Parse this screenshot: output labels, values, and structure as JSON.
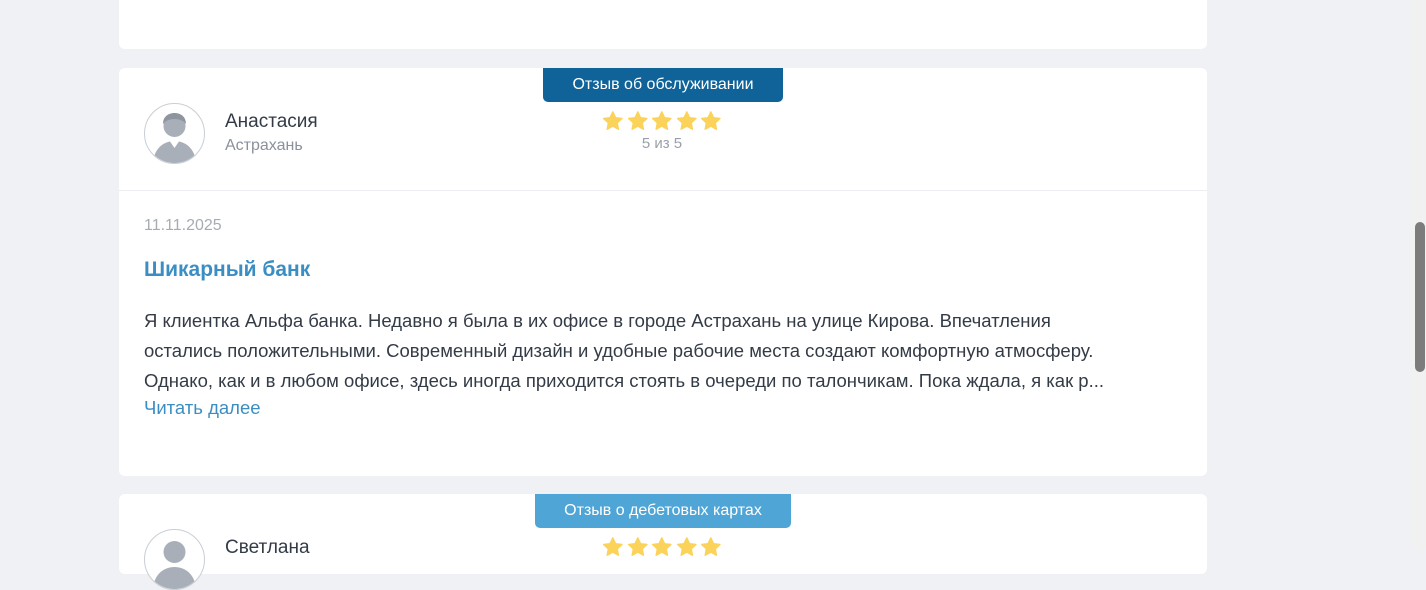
{
  "review": {
    "category": "Отзыв об обслуживании",
    "author_name": "Анастасия",
    "author_city": "Астрахань",
    "rating": 5,
    "rating_text": "5 из 5",
    "date": "11.11.2025",
    "title": "Шикарный банк",
    "body_lines": [
      "Я клиентка Альфа банка. Недавно я была в их офисе в городе Астрахань на улице Кирова. Впечатления",
      "остались положительными. Современный дизайн и удобные рабочие места создают комфортную атмосферу.",
      "Однако, как и в любом офисе, здесь иногда приходится стоять в очереди по талончикам. Пока ждала, я как р..."
    ],
    "read_more": "Читать далее"
  },
  "next_review": {
    "category": "Отзыв о дебетовых картах",
    "author_name": "Светлана",
    "rating": 5
  },
  "colors": {
    "page_background": "#eff1f4",
    "card_background": "#ffffff",
    "service_tag": "#0f6399",
    "debit_tag": "#4ea5d6",
    "title_link": "#3a8ec3",
    "star": "#fbd35b"
  },
  "icons": {
    "avatar": "user-avatar-icon",
    "star": "star-icon"
  }
}
